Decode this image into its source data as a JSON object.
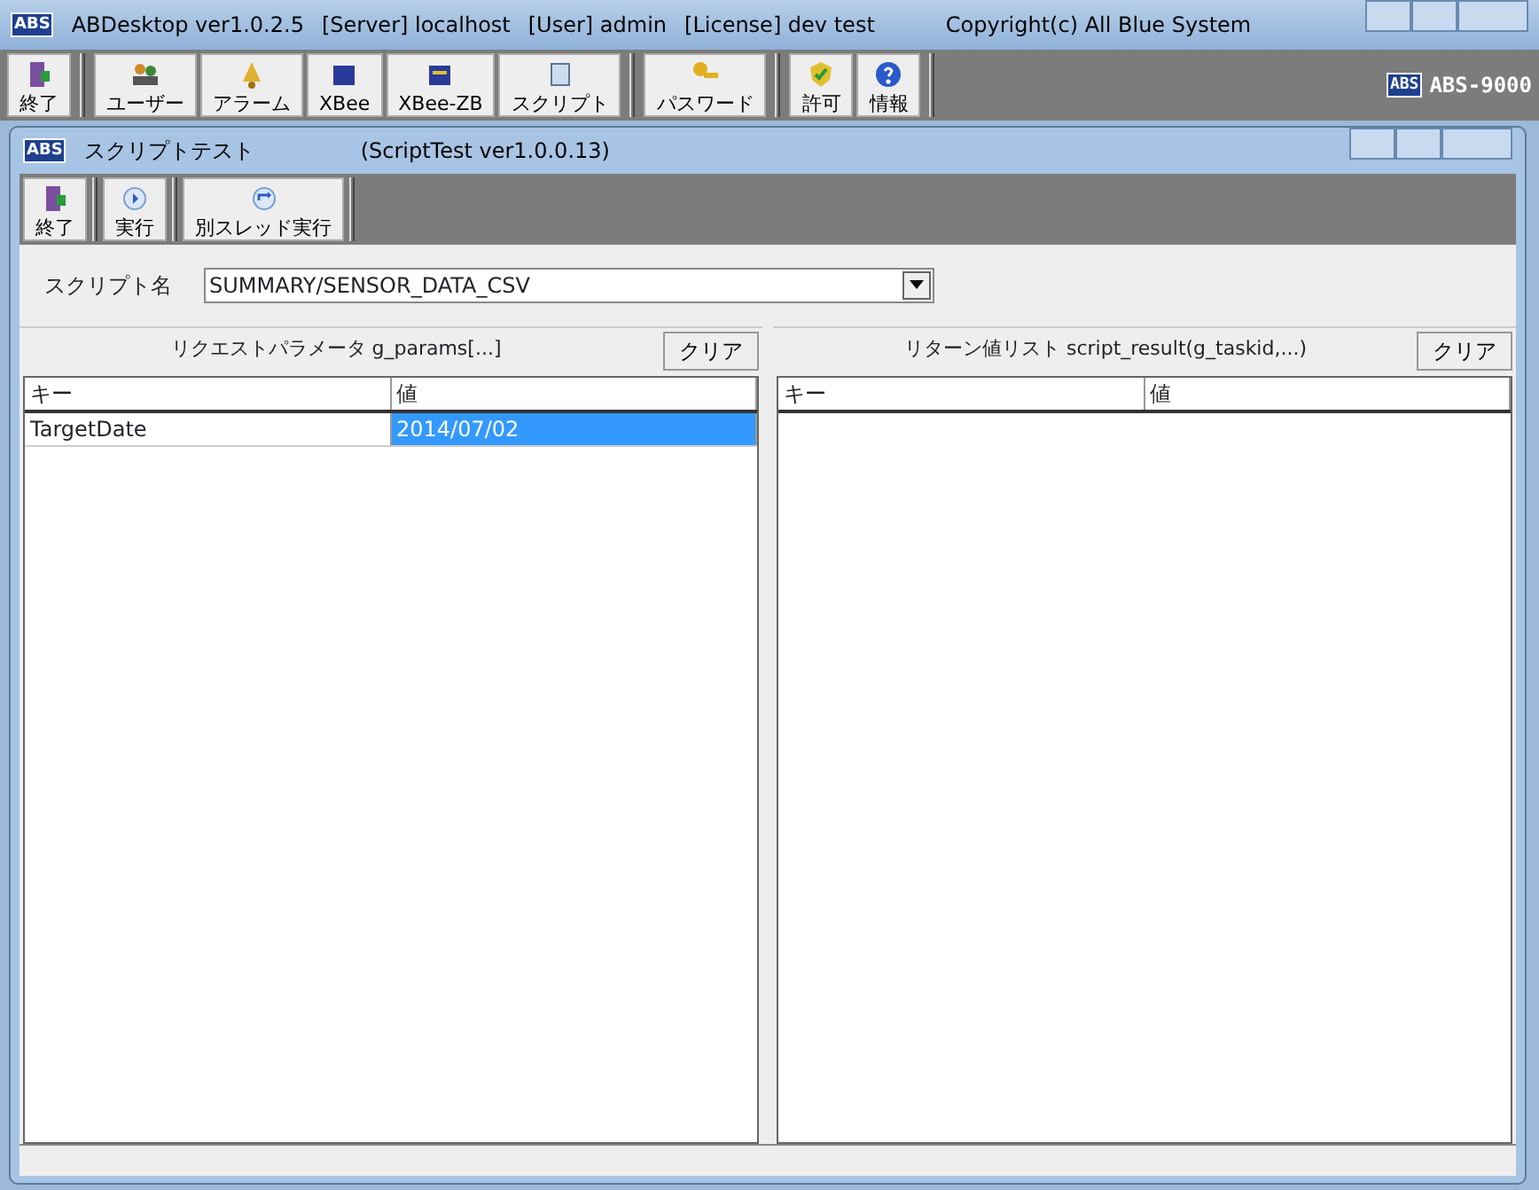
{
  "app_window": {
    "title_parts": [
      "ABDesktop ver1.0.2.5",
      "[Server] localhost",
      "[User] admin",
      "[License] dev test"
    ],
    "copyright": "Copyright(c) All Blue System",
    "logo": "ABS",
    "brand_logo": "ABS",
    "brand": "ABS-9000"
  },
  "toolbar": [
    [
      "終了"
    ],
    [
      "ユーザー",
      "アラーム",
      "XBee",
      "XBee-ZB",
      "スクリプト"
    ],
    [
      "パスワード"
    ],
    [
      "許可",
      "情報"
    ]
  ],
  "script_window": {
    "title": "スクリプトテスト",
    "version": "(ScriptTest ver1.0.0.13)",
    "logo": "ABS",
    "toolbar": [
      [
        "終了"
      ],
      [
        "実行"
      ],
      [
        "別スレッド実行"
      ]
    ],
    "script_label": "スクリプト名",
    "script_value": "SUMMARY/SENSOR_DATA_CSV",
    "panels": [
      {
        "title": "リクエストパラメータ g_params[...]",
        "clear": "クリア",
        "columns": [
          "キー",
          "値"
        ],
        "rows": [
          {
            "key": "TargetDate",
            "value": "2014/07/02",
            "selected": true
          }
        ]
      },
      {
        "title": "リターン値リスト script_result(g_taskid,...)",
        "clear": "クリア",
        "columns": [
          "キー",
          "値"
        ]
      }
    ]
  }
}
